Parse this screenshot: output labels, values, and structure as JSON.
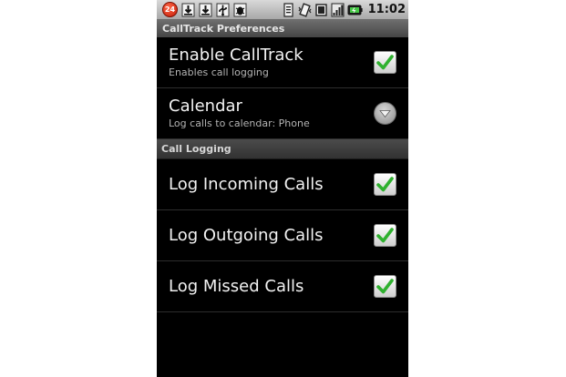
{
  "statusbar": {
    "notification_count": "24",
    "time": "11:02",
    "icons": [
      "notification-badge",
      "download-icon",
      "download-icon",
      "usb-icon",
      "debug-icon",
      "sim-icon",
      "vibrate-icon",
      "sd-card-icon",
      "signal-icon",
      "battery-icon"
    ]
  },
  "title": "CallTrack Preferences",
  "prefs": {
    "enable": {
      "title": "Enable CallTrack",
      "summary": "Enables call logging",
      "checked": true
    },
    "calendar": {
      "title": "Calendar",
      "summary": "Log calls to calendar: Phone"
    }
  },
  "category": "Call Logging",
  "logging": [
    {
      "title": "Log Incoming Calls",
      "checked": true
    },
    {
      "title": "Log Outgoing Calls",
      "checked": true
    },
    {
      "title": "Log Missed Calls",
      "checked": true
    }
  ],
  "colors": {
    "check_green": "#2fb12f",
    "background": "#000000"
  }
}
